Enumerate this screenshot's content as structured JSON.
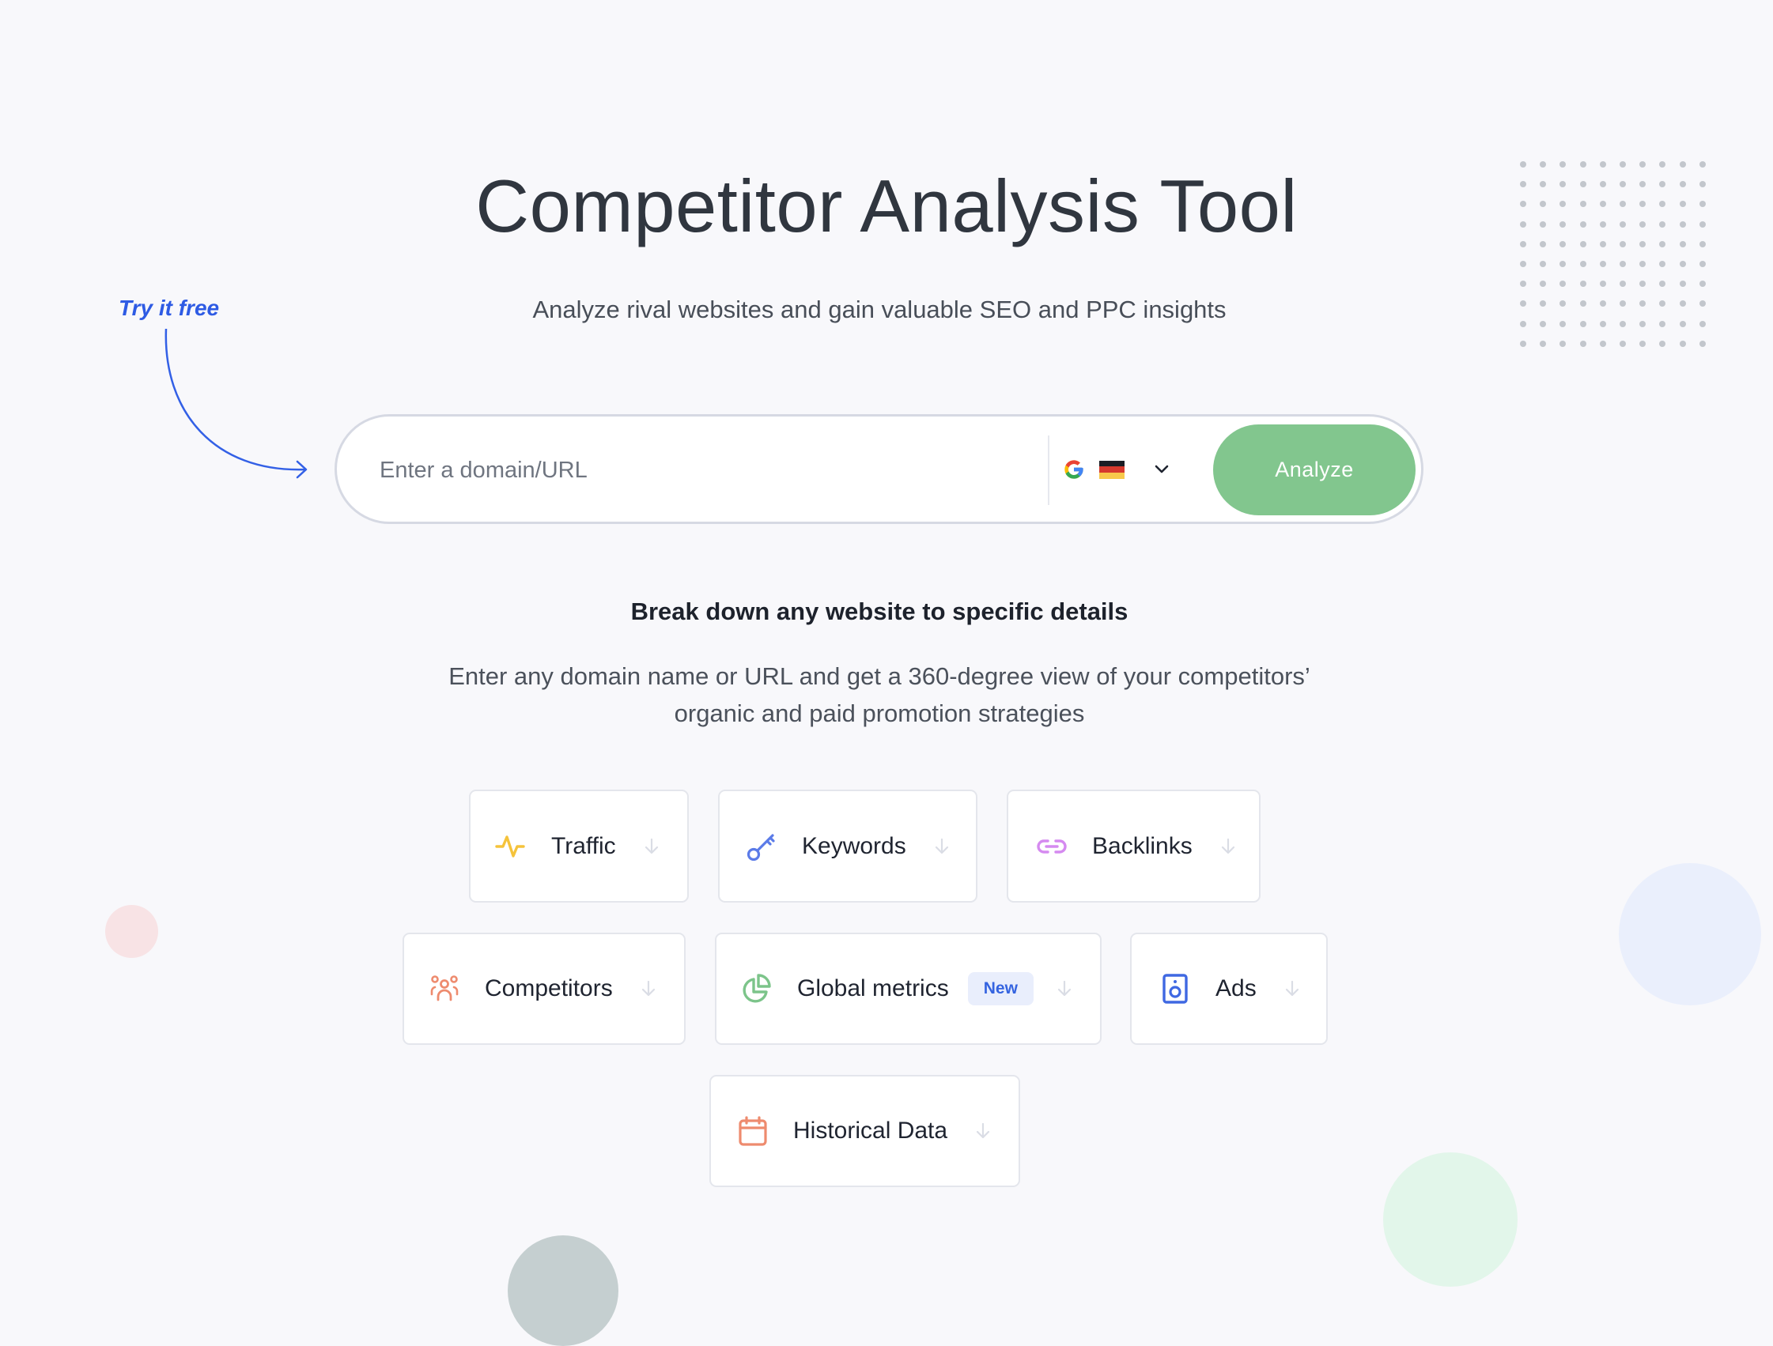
{
  "header": {
    "title": "Competitor Analysis Tool",
    "subtitle": "Analyze rival websites and gain valuable SEO and PPC insights"
  },
  "callout": {
    "label": "Try it free",
    "icon": "curved-arrow-icon"
  },
  "search": {
    "placeholder": "Enter a domain/URL",
    "value": "",
    "engine_icon": "google-icon",
    "country_icon": "germany-flag-icon",
    "dropdown_icon": "chevron-down-icon",
    "submit_label": "Analyze"
  },
  "section": {
    "heading": "Break down any website to specific details",
    "description_line1": "Enter any domain name or URL and get a 360-degree view of your competitors’",
    "description_line2": "organic and paid promotion strategies"
  },
  "features": [
    {
      "label": "Traffic",
      "icon": "pulse-icon",
      "color": "#F5C33B"
    },
    {
      "label": "Keywords",
      "icon": "key-icon",
      "color": "#5B7BE8"
    },
    {
      "label": "Backlinks",
      "icon": "link-icon",
      "color": "#D58AF0"
    },
    {
      "label": "Competitors",
      "icon": "users-icon",
      "color": "#EE8B6E"
    },
    {
      "label": "Global metrics",
      "icon": "pie-chart-icon",
      "color": "#7CC48A",
      "badge": "New"
    },
    {
      "label": "Ads",
      "icon": "ad-speaker-icon",
      "color": "#3F68E2"
    },
    {
      "label": "Historical Data",
      "icon": "calendar-icon",
      "color": "#EE8B6E"
    }
  ],
  "colors": {
    "background": "#F8F8FB",
    "accent_green": "#82C68E",
    "accent_blue": "#2E5BE4",
    "badge_bg": "#E9EEFC",
    "badge_text": "#3564E0"
  }
}
